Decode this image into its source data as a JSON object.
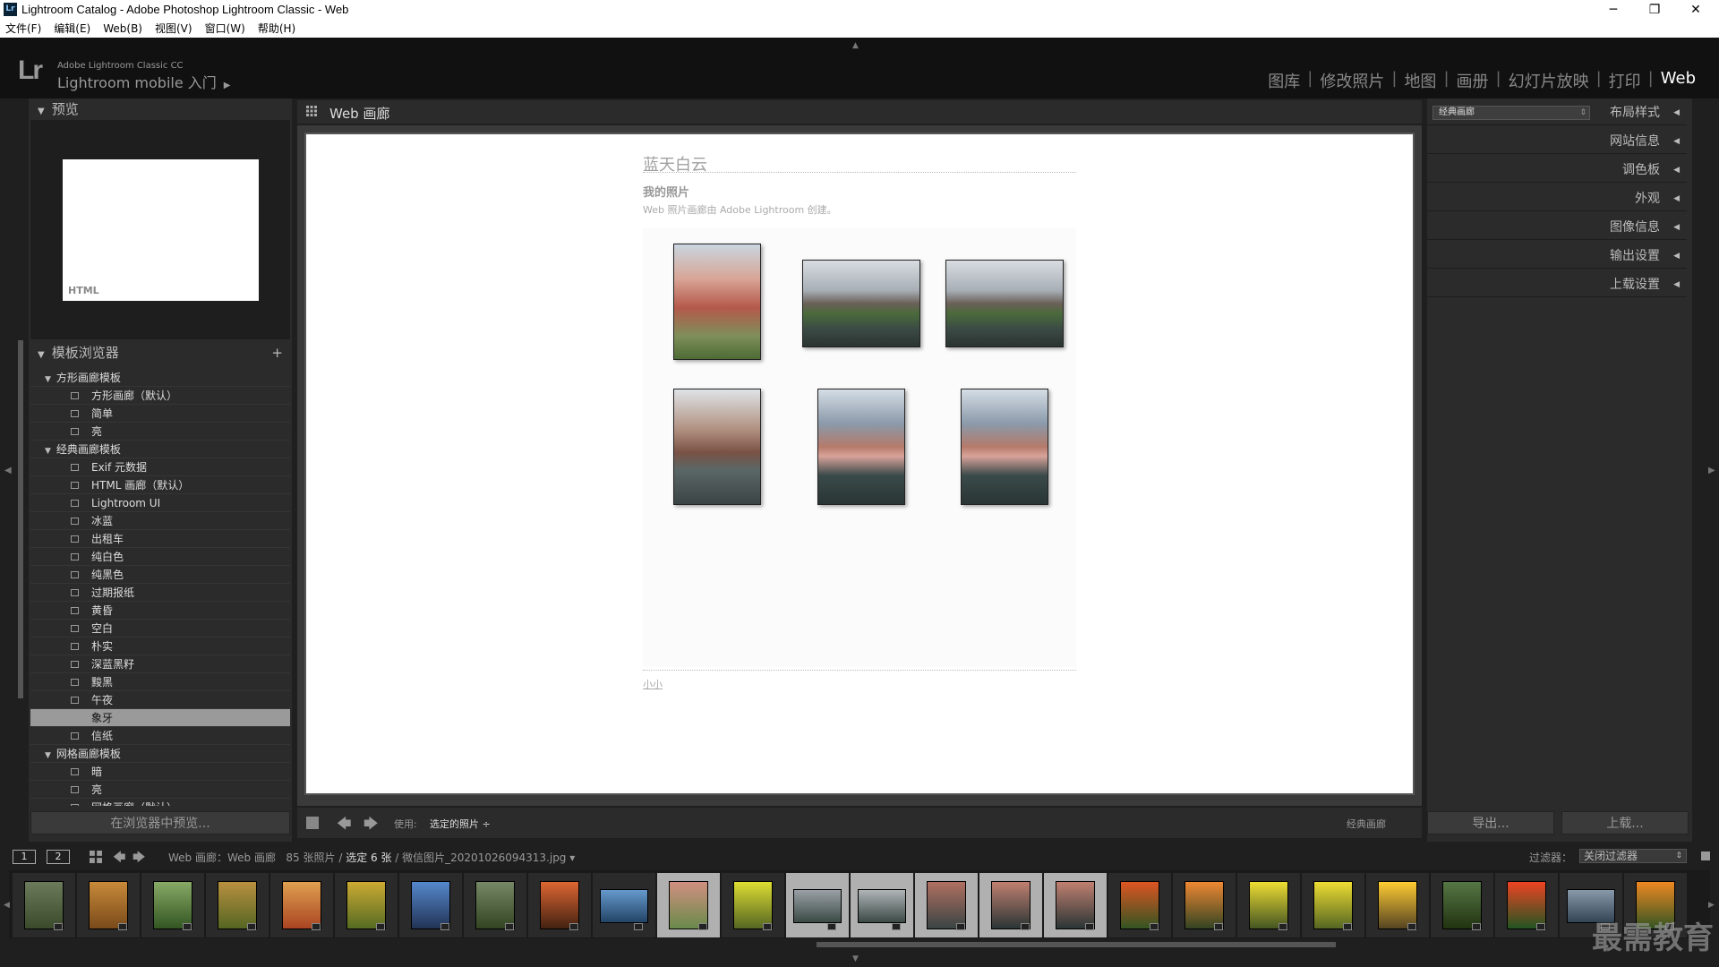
{
  "window": {
    "app_icon": "Lr",
    "title": "Lightroom Catalog - Adobe Photoshop Lightroom Classic - Web",
    "controls": [
      "─",
      "❐",
      "✕"
    ]
  },
  "menu": [
    "文件(F)",
    "编辑(E)",
    "Web(B)",
    "视图(V)",
    "窗口(W)",
    "帮助(H)"
  ],
  "identity": {
    "logo": "Lr",
    "line1": "Adobe Lightroom Classic CC",
    "line2": "Lightroom mobile 入门"
  },
  "modules": [
    "图库",
    "修改照片",
    "地图",
    "画册",
    "幻灯片放映",
    "打印",
    "Web"
  ],
  "module_separator": "|",
  "active_module": "Web",
  "left_panel": {
    "preview_header": "预览",
    "preview_html_label": "HTML",
    "template_header": "模板浏览器",
    "add_icon": "+",
    "templates": [
      {
        "type": "folder",
        "label": "方形画廊模板"
      },
      {
        "type": "item",
        "label": "方形画廊（默认）"
      },
      {
        "type": "item",
        "label": "简单"
      },
      {
        "type": "item",
        "label": "亮"
      },
      {
        "type": "folder",
        "label": "经典画廊模板"
      },
      {
        "type": "item",
        "label": "Exif 元数据"
      },
      {
        "type": "item",
        "label": "HTML 画廊（默认）"
      },
      {
        "type": "item",
        "label": "Lightroom UI"
      },
      {
        "type": "item",
        "label": "冰蓝"
      },
      {
        "type": "item",
        "label": "出租车"
      },
      {
        "type": "item",
        "label": "纯白色"
      },
      {
        "type": "item",
        "label": "纯黑色"
      },
      {
        "type": "item",
        "label": "过期报纸"
      },
      {
        "type": "item",
        "label": "黄昏"
      },
      {
        "type": "item",
        "label": "空白"
      },
      {
        "type": "item",
        "label": "朴实"
      },
      {
        "type": "item",
        "label": "深蓝黑籽"
      },
      {
        "type": "item",
        "label": "黢黑"
      },
      {
        "type": "item",
        "label": "午夜"
      },
      {
        "type": "item",
        "label": "象牙",
        "selected": true
      },
      {
        "type": "item",
        "label": "信纸"
      },
      {
        "type": "folder",
        "label": "网格画廊模板"
      },
      {
        "type": "item",
        "label": "暗"
      },
      {
        "type": "item",
        "label": "亮"
      },
      {
        "type": "item",
        "label": "网格画廊（默认）"
      }
    ],
    "preview_in_browser_button": "在浏览器中预览..."
  },
  "center": {
    "header": "Web 画廊",
    "gallery": {
      "site_title": "蓝天白云",
      "collection_title": "我的照片",
      "description": "Web 照片画廊由 Adobe Lightroom 创建。",
      "contact": "小小"
    },
    "toolbar": {
      "use_label": "使用:",
      "use_value": "选定的照片 ÷",
      "layout_name": "经典画廊"
    }
  },
  "right_panel": {
    "layout_style_value": "经典画廊",
    "sections": [
      "布局样式",
      "网站信息",
      "调色板",
      "外观",
      "图像信息",
      "输出设置",
      "上载设置"
    ],
    "export_button": "导出...",
    "upload_button": "上载..."
  },
  "filmbar": {
    "page1": "1",
    "page2": "2",
    "source": "Web 画廊：Web 画廊",
    "count": "85 张照片 /",
    "selected": "选定 6 张",
    "filename": "/ 微信图片_20201026094313.jpg",
    "filter_label": "过滤器：",
    "filter_value": "关闭过滤器"
  },
  "watermark": "最需教育"
}
